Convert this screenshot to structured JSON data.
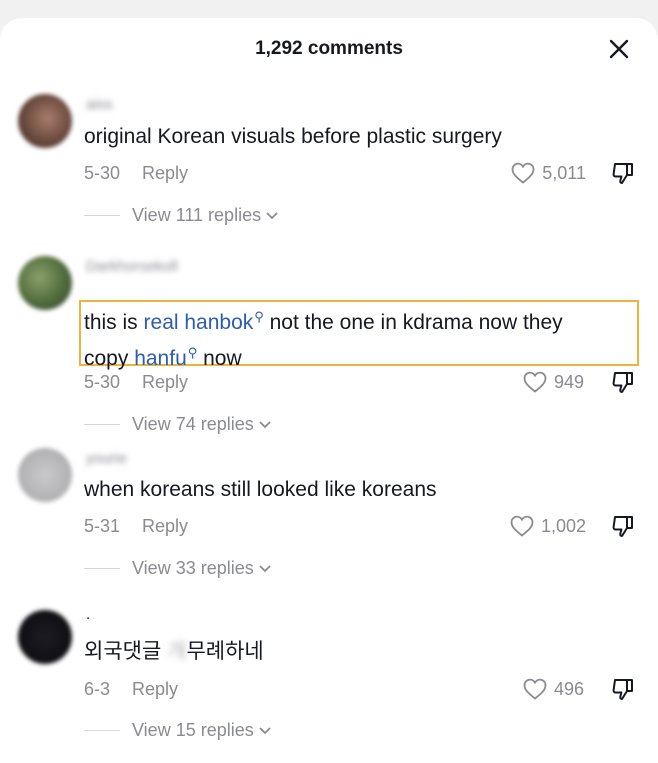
{
  "header": {
    "title": "1,292 comments"
  },
  "comments": [
    {
      "username": "aiss",
      "text": "original Korean visuals before plastic surgery",
      "date": "5-30",
      "reply_label": "Reply",
      "likes": "5,011",
      "view_replies": "View 111 replies"
    },
    {
      "username": "Darkhorsekoll",
      "text_parts": [
        "this is ",
        "real hanbok",
        " not the one in kdrama now they",
        "copy ",
        "hanfu",
        " now"
      ],
      "date": "5-30",
      "reply_label": "Reply",
      "likes": "949",
      "view_replies": "View 74 replies"
    },
    {
      "username": "yourie",
      "text": "when koreans still looked like koreans",
      "date": "5-31",
      "reply_label": "Reply",
      "likes": "1,002",
      "view_replies": "View 33 replies"
    },
    {
      "username": ".",
      "text_parts": [
        "외국댓글 ",
        "개",
        "무례하네"
      ],
      "date": "6-3",
      "reply_label": "Reply",
      "likes": "496",
      "view_replies": "View 15 replies"
    }
  ],
  "colors": {
    "keyword": "#2b5db3",
    "highlight": "#f0b23a",
    "muted": "#8a8b91"
  }
}
